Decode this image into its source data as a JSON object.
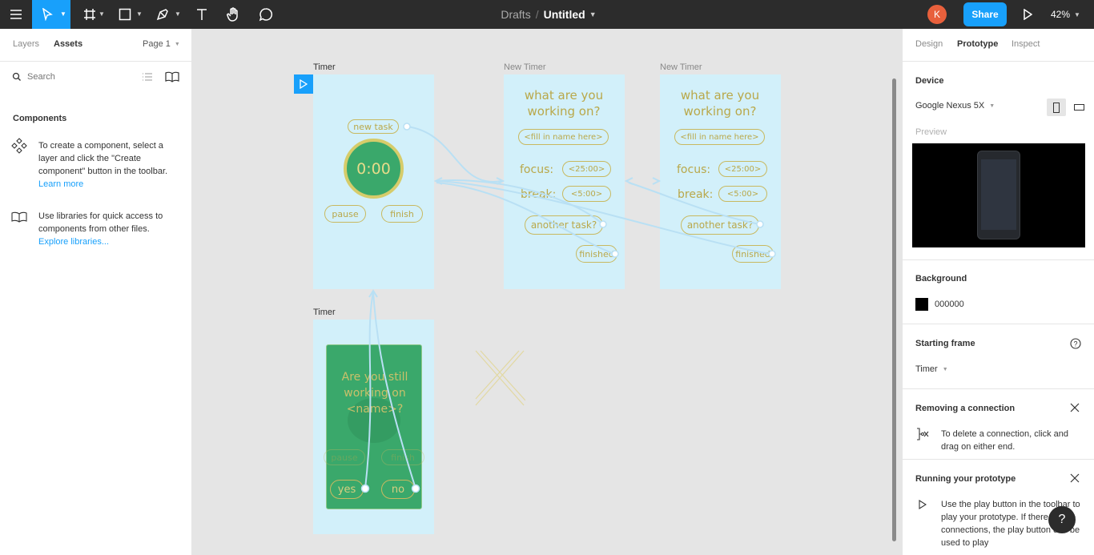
{
  "topbar": {
    "breadcrumb_parent": "Drafts",
    "breadcrumb_sep": "/",
    "file_name": "Untitled",
    "avatar_initial": "K",
    "share_label": "Share",
    "zoom": "42%"
  },
  "left": {
    "tabs": [
      "Layers",
      "Assets"
    ],
    "page_label": "Page 1",
    "search_placeholder": "Search",
    "components_title": "Components",
    "create_text": "To create a component, select a layer and click the \"Create component\" button in the toolbar.",
    "learn_more": "Learn more",
    "libraries_text": "Use libraries for quick access to components from other files.",
    "explore_libraries": "Explore libraries..."
  },
  "canvas": {
    "frames": [
      {
        "label": "Timer"
      },
      {
        "label": "New Timer"
      },
      {
        "label": "New Timer"
      },
      {
        "label": "Timer"
      }
    ],
    "timer": {
      "new_task": "new task",
      "clock": "0:00",
      "pause": "pause",
      "finish": "finish"
    },
    "new_timer": {
      "question": "what are you working on?",
      "name_field": "<fill in name here>",
      "focus_label": "focus:",
      "focus_value": "<25:00>",
      "break_label": "break:",
      "break_value": "<5:00>",
      "another_task": "another task?",
      "finished": "finished"
    },
    "dialog": {
      "question": "Are you still working on <name>?",
      "yes": "yes",
      "no": "no",
      "ghost_pause": "pause",
      "ghost_finish": "finish"
    }
  },
  "right": {
    "tabs": [
      "Design",
      "Prototype",
      "Inspect"
    ],
    "active_tab": "Prototype",
    "device_title": "Device",
    "device_name": "Google Nexus 5X",
    "preview_label": "Preview",
    "background_title": "Background",
    "background_hex": "000000",
    "starting_frame_title": "Starting frame",
    "starting_frame_value": "Timer",
    "removing_title": "Removing a connection",
    "removing_text": "To delete a connection, click and drag on either end.",
    "running_title": "Running your prototype",
    "running_text": "Use the play button in the toolbar to play your prototype. If there are no connections, the play button can be used to play",
    "help_label": "?"
  },
  "colors": {
    "accent": "#18a0fb",
    "frame_bg": "#d2f0fa",
    "gold": "#c8b960",
    "green": "#3aa86b",
    "toolbar": "#2c2c2c"
  }
}
